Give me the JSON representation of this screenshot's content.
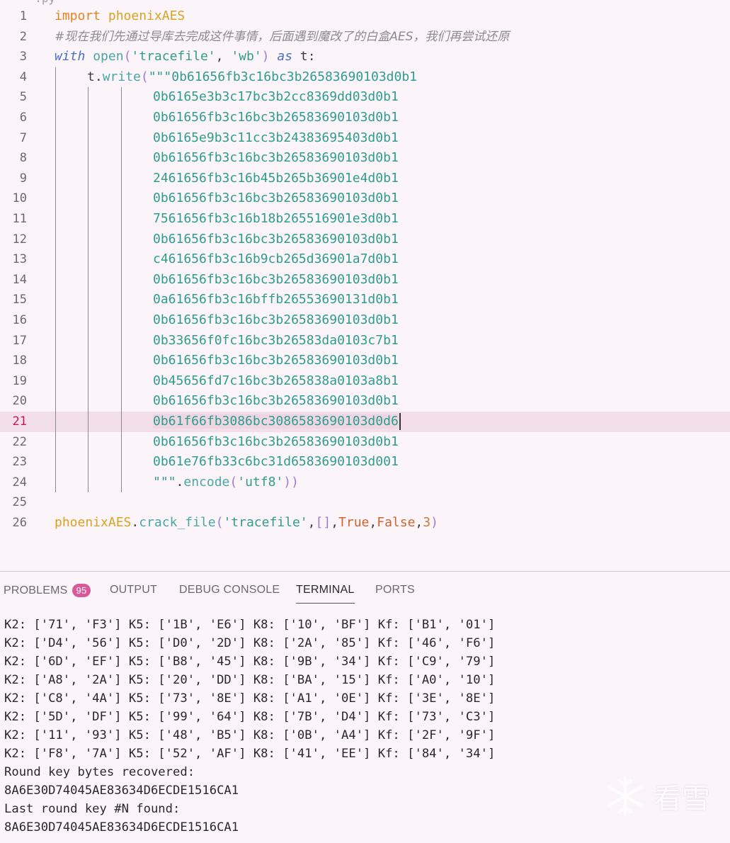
{
  "editor": {
    "lines": [
      {
        "n": "1",
        "tokens": [
          {
            "t": "import",
            "c": "kw"
          },
          {
            "t": " ",
            "c": "var"
          },
          {
            "t": "phoenixAES",
            "c": "mod"
          }
        ],
        "indent": 0
      },
      {
        "n": "2",
        "tokens": [
          {
            "t": "#现在我们先通过导库去完成这件事情，后面遇到魔改了的白盒AES，我们再尝试还原",
            "c": "cm"
          }
        ],
        "indent": 0
      },
      {
        "n": "3",
        "tokens": [
          {
            "t": "with",
            "c": "kw2"
          },
          {
            "t": " ",
            "c": "var"
          },
          {
            "t": "open",
            "c": "fn"
          },
          {
            "t": "(",
            "c": "pun"
          },
          {
            "t": "'tracefile'",
            "c": "str"
          },
          {
            "t": ", ",
            "c": "var"
          },
          {
            "t": "'wb'",
            "c": "str"
          },
          {
            "t": ")",
            "c": "pun"
          },
          {
            "t": " ",
            "c": "var"
          },
          {
            "t": "as",
            "c": "kw2"
          },
          {
            "t": " t:",
            "c": "var"
          }
        ],
        "indent": 0
      },
      {
        "n": "4",
        "tokens": [
          {
            "t": "t",
            "c": "var"
          },
          {
            "t": ".",
            "c": "var"
          },
          {
            "t": "write",
            "c": "fn"
          },
          {
            "t": "(",
            "c": "pun"
          },
          {
            "t": "\"\"\"0b61656fb3c16bc3b26583690103d0b1",
            "c": "str"
          }
        ],
        "indent": 1
      },
      {
        "n": "5",
        "tokens": [
          {
            "t": "0b6165e3b3c17bc3b2cc8369dd03d0b1",
            "c": "hex"
          }
        ],
        "indent": 2
      },
      {
        "n": "6",
        "tokens": [
          {
            "t": "0b61656fb3c16bc3b26583690103d0b1",
            "c": "hex"
          }
        ],
        "indent": 2
      },
      {
        "n": "7",
        "tokens": [
          {
            "t": "0b6165e9b3c11cc3b24383695403d0b1",
            "c": "hex"
          }
        ],
        "indent": 2
      },
      {
        "n": "8",
        "tokens": [
          {
            "t": "0b61656fb3c16bc3b26583690103d0b1",
            "c": "hex"
          }
        ],
        "indent": 2
      },
      {
        "n": "9",
        "tokens": [
          {
            "t": "2461656fb3c16b45b265b36901e4d0b1",
            "c": "hex"
          }
        ],
        "indent": 2
      },
      {
        "n": "10",
        "tokens": [
          {
            "t": "0b61656fb3c16bc3b26583690103d0b1",
            "c": "hex"
          }
        ],
        "indent": 2
      },
      {
        "n": "11",
        "tokens": [
          {
            "t": "7561656fb3c16b18b265516901e3d0b1",
            "c": "hex"
          }
        ],
        "indent": 2
      },
      {
        "n": "12",
        "tokens": [
          {
            "t": "0b61656fb3c16bc3b26583690103d0b1",
            "c": "hex"
          }
        ],
        "indent": 2
      },
      {
        "n": "13",
        "tokens": [
          {
            "t": "c461656fb3c16b9cb265d36901a7d0b1",
            "c": "hex"
          }
        ],
        "indent": 2
      },
      {
        "n": "14",
        "tokens": [
          {
            "t": "0b61656fb3c16bc3b26583690103d0b1",
            "c": "hex"
          }
        ],
        "indent": 2
      },
      {
        "n": "15",
        "tokens": [
          {
            "t": "0a61656fb3c16bffb26553690131d0b1",
            "c": "hex"
          }
        ],
        "indent": 2
      },
      {
        "n": "16",
        "tokens": [
          {
            "t": "0b61656fb3c16bc3b26583690103d0b1",
            "c": "hex"
          }
        ],
        "indent": 2
      },
      {
        "n": "17",
        "tokens": [
          {
            "t": "0b33656f0fc16bc3b26583da0103c7b1",
            "c": "hex"
          }
        ],
        "indent": 2
      },
      {
        "n": "18",
        "tokens": [
          {
            "t": "0b61656fb3c16bc3b26583690103d0b1",
            "c": "hex"
          }
        ],
        "indent": 2
      },
      {
        "n": "19",
        "tokens": [
          {
            "t": "0b45656fd7c16bc3b265838a0103a8b1",
            "c": "hex"
          }
        ],
        "indent": 2
      },
      {
        "n": "20",
        "tokens": [
          {
            "t": "0b61656fb3c16bc3b26583690103d0b1",
            "c": "hex"
          }
        ],
        "indent": 2
      },
      {
        "n": "21",
        "tokens": [
          {
            "t": "0b61f66fb3086bc3086583690103d0d6",
            "c": "hex"
          }
        ],
        "indent": 2,
        "current": true
      },
      {
        "n": "22",
        "tokens": [
          {
            "t": "0b61656fb3c16bc3b26583690103d0b1",
            "c": "hex"
          }
        ],
        "indent": 2
      },
      {
        "n": "23",
        "tokens": [
          {
            "t": "0b61e76fb33c6bc31d6583690103d001",
            "c": "hex"
          }
        ],
        "indent": 2
      },
      {
        "n": "24",
        "tokens": [
          {
            "t": "\"\"\"",
            "c": "str"
          },
          {
            "t": ".",
            "c": "var"
          },
          {
            "t": "encode",
            "c": "fn"
          },
          {
            "t": "(",
            "c": "pun"
          },
          {
            "t": "'utf8'",
            "c": "str"
          },
          {
            "t": ")",
            "c": "pun"
          },
          {
            "t": ")",
            "c": "pun"
          }
        ],
        "indent": 2
      },
      {
        "n": "25",
        "tokens": [],
        "indent": 0
      },
      {
        "n": "26",
        "tokens": [
          {
            "t": "phoenixAES",
            "c": "mod"
          },
          {
            "t": ".",
            "c": "var"
          },
          {
            "t": "crack_file",
            "c": "fn"
          },
          {
            "t": "(",
            "c": "pun"
          },
          {
            "t": "'tracefile'",
            "c": "str"
          },
          {
            "t": ",",
            "c": "var"
          },
          {
            "t": "[]",
            "c": "pun"
          },
          {
            "t": ",",
            "c": "var"
          },
          {
            "t": "True",
            "c": "cst"
          },
          {
            "t": ",",
            "c": "var"
          },
          {
            "t": "False",
            "c": "cst"
          },
          {
            "t": ",",
            "c": "var"
          },
          {
            "t": "3",
            "c": "num"
          },
          {
            "t": ")",
            "c": "pun"
          }
        ],
        "indent": 0
      }
    ]
  },
  "panel": {
    "tabs": [
      {
        "label": "PROBLEMS",
        "badge": "95",
        "active": false
      },
      {
        "label": "OUTPUT",
        "active": false
      },
      {
        "label": "DEBUG CONSOLE",
        "active": false
      },
      {
        "label": "TERMINAL",
        "active": true
      },
      {
        "label": "PORTS",
        "active": false
      }
    ],
    "terminal_lines": [
      "K2: ['71', 'F3'] K5: ['1B', 'E6'] K8: ['10', 'BF'] Kf: ['B1', '01']",
      "K2: ['D4', '56'] K5: ['D0', '2D'] K8: ['2A', '85'] Kf: ['46', 'F6']",
      "K2: ['6D', 'EF'] K5: ['B8', '45'] K8: ['9B', '34'] Kf: ['C9', '79']",
      "K2: ['A8', '2A'] K5: ['20', 'DD'] K8: ['BA', '15'] Kf: ['A0', '10']",
      "K2: ['C8', '4A'] K5: ['73', '8E'] K8: ['A1', '0E'] Kf: ['3E', '8E']",
      "K2: ['5D', 'DF'] K5: ['99', '64'] K8: ['7B', 'D4'] Kf: ['73', 'C3']",
      "K2: ['11', '93'] K5: ['48', 'B5'] K8: ['0B', 'A4'] Kf: ['2F', '9F']",
      "K2: ['F8', '7A'] K5: ['52', 'AF'] K8: ['41', 'EE'] Kf: ['84', '34']",
      "Round key bytes recovered:",
      "8A6E30D74045AE83634D6ECDE1516CA1",
      "Last round key #N found:",
      "8A6E30D74045AE83634D6ECDE1516CA1"
    ]
  },
  "watermark": {
    "text": "看雪",
    "icon": "snowflake-icon"
  }
}
